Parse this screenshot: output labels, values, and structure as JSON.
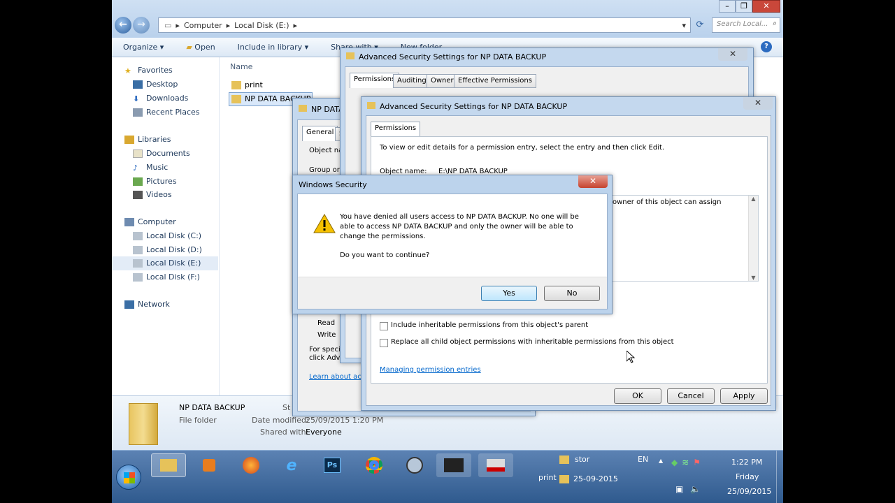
{
  "explorer": {
    "address": {
      "crumbs": [
        "Computer",
        "Local Disk (E:)"
      ]
    },
    "search_placeholder": "Search Local...",
    "toolbar": {
      "organize": "Organize",
      "open": "Open",
      "include": "Include in library",
      "share": "Share with",
      "newfolder": "New folder"
    },
    "nav": {
      "favorites": "Favorites",
      "desktop": "Desktop",
      "downloads": "Downloads",
      "recent": "Recent Places",
      "libraries": "Libraries",
      "documents": "Documents",
      "music": "Music",
      "pictures": "Pictures",
      "videos": "Videos",
      "computer": "Computer",
      "disk_c": "Local Disk (C:)",
      "disk_d": "Local Disk (D:)",
      "disk_e": "Local Disk (E:)",
      "disk_f": "Local Disk (F:)",
      "network": "Network"
    },
    "column_name": "Name",
    "files": [
      "print",
      "NP DATA BACKUP"
    ],
    "details": {
      "name": "NP DATA BACKUP",
      "type": "File folder",
      "modified_label": "Date modified:",
      "modified": "25/09/2015 1:20 PM",
      "shared_label": "Shared with:",
      "shared": "Everyone",
      "state_prefix": "St"
    }
  },
  "properties": {
    "title": "NP DATA",
    "tabs": [
      "General",
      "S"
    ],
    "object_label": "Object na",
    "group_label": "Group or u",
    "perm_read": "Read",
    "perm_write": "Write",
    "special_1": "For speci",
    "special_2": "click Adv",
    "learn": "Learn about acc"
  },
  "adv1": {
    "title": "Advanced Security Settings for NP DATA BACKUP",
    "tabs": [
      "Permissions",
      "Auditing",
      "Owner",
      "Effective Permissions"
    ],
    "close": "✕"
  },
  "adv2": {
    "title": "Advanced Security Settings for NP DATA BACKUP",
    "tab": "Permissions",
    "intro": "To view or edit details for a permission entry, select the entry and then click Edit.",
    "object_label": "Object name:",
    "object_value": "E:\\NP DATA BACKUP",
    "owner_note": "owner of this object can assign",
    "cb_include": "Include inheritable permissions from this object's parent",
    "cb_replace": "Replace all child object permissions with inheritable permissions from this object",
    "manage_link": "Managing permission entries",
    "ok": "OK",
    "cancel": "Cancel",
    "apply": "Apply",
    "close": "✕"
  },
  "security": {
    "title": "Windows Security",
    "message": "You have denied all users access to NP DATA BACKUP. No one will be able to access NP DATA BACKUP and only the owner will be able to change the permissions.",
    "question": "Do you want to continue?",
    "yes": "Yes",
    "no": "No",
    "close": "✕"
  },
  "taskbar": {
    "ps": "Ps",
    "stor": "stor",
    "print": "print",
    "date_short": "25-09-2015",
    "lang": "EN",
    "time": "1:22 PM",
    "day": "Friday",
    "date": "25/09/2015"
  },
  "colors": {
    "desktop": "#7a9cc4",
    "taskbar": "#2f5a8e",
    "dialog_frame": "#c4d8ee",
    "accent_link": "#0066cc"
  }
}
